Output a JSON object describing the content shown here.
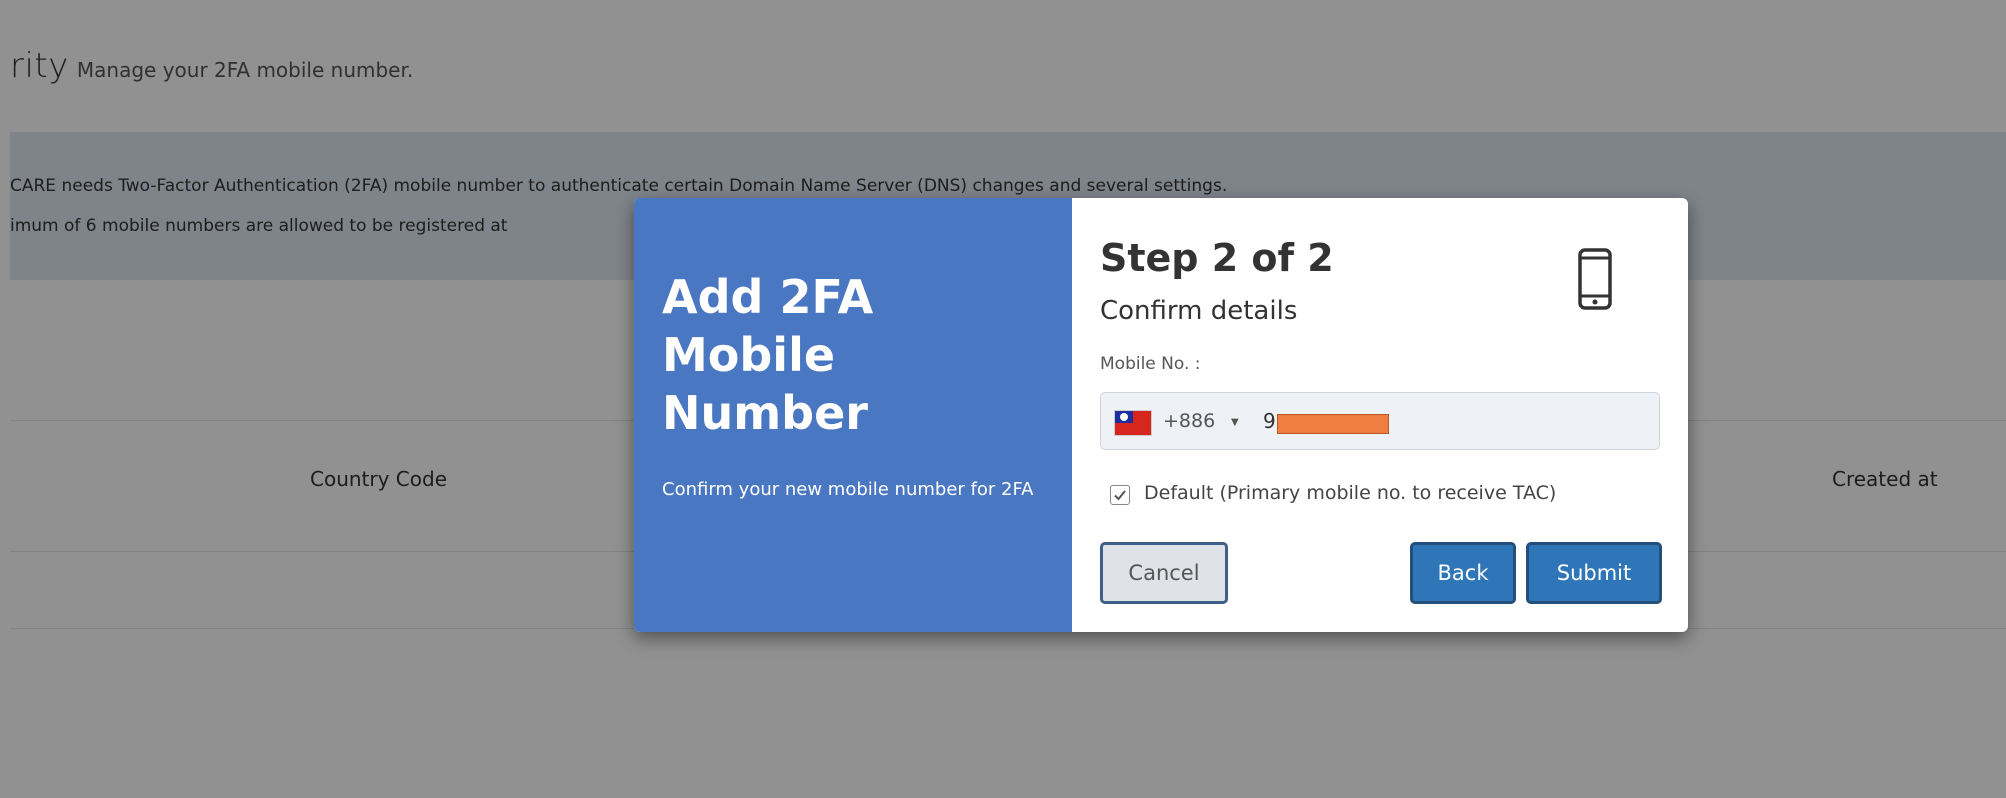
{
  "background": {
    "title_fragment": "rity",
    "title_subtext": "Manage your 2FA mobile number.",
    "info_line_1": "CARE needs Two-Factor Authentication (2FA) mobile number to authenticate certain Domain Name Server (DNS) changes and several settings.",
    "info_line_2": "imum of 6 mobile numbers are allowed to be registered at",
    "table_headers": {
      "country_code": "Country Code",
      "created_at": "Created at"
    }
  },
  "modal": {
    "left": {
      "title": "Add 2FA Mobile Number",
      "subtitle": "Confirm your new mobile number for 2FA"
    },
    "step_title": "Step 2 of 2",
    "step_subtitle": "Confirm details",
    "icon": "mobile-phone-icon",
    "mobile_label": "Mobile No. :",
    "country_flag": "taiwan-flag",
    "dial_code": "+886",
    "mobile_value_visible": "9",
    "default_checkbox": {
      "checked": true,
      "label": "Default (Primary mobile no. to receive TAC)"
    },
    "buttons": {
      "cancel": "Cancel",
      "back": "Back",
      "submit": "Submit"
    }
  },
  "colors": {
    "modal_left_bg": "#4a77c1",
    "primary_button": "#2f76b9",
    "redaction": "#ef7f41",
    "info_bg": "#dfe8f5"
  }
}
